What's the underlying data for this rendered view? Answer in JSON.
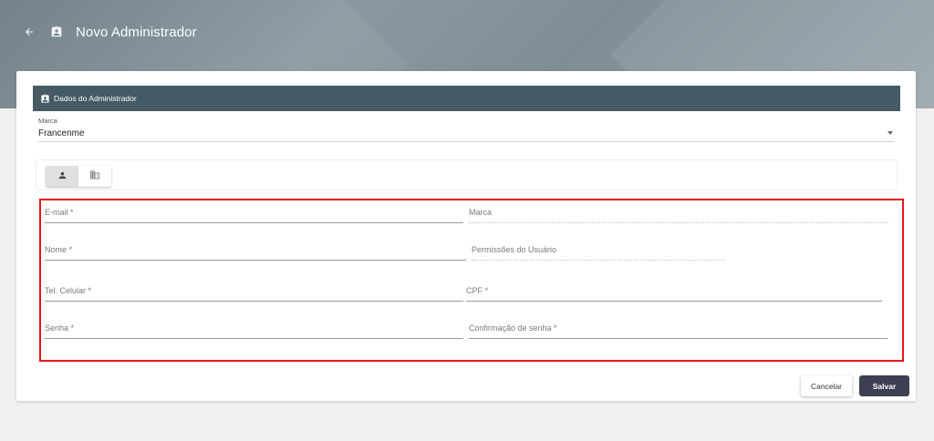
{
  "header": {
    "title": "Novo Administrador"
  },
  "section": {
    "title": "Dados do Administrador"
  },
  "marca_select": {
    "label": "Marca",
    "value": "Francenme"
  },
  "tabs": [
    {
      "icon": "person-icon",
      "active": true
    },
    {
      "icon": "business-icon",
      "active": false
    }
  ],
  "form": {
    "email": "E-mail *",
    "marca": "Marca",
    "nome": "Nome *",
    "permissoes": "Permissões do Usuário",
    "celular": "Tel. Celular *",
    "cpf": "CPF *",
    "senha": "Senha *",
    "confirmacao": "Confirmação de senha *"
  },
  "actions": {
    "cancel": "Cancelar",
    "save": "Salvar"
  },
  "colors": {
    "section_bar": "#455a64",
    "save_button": "#3c4050",
    "highlight_border": "#e8151b"
  }
}
